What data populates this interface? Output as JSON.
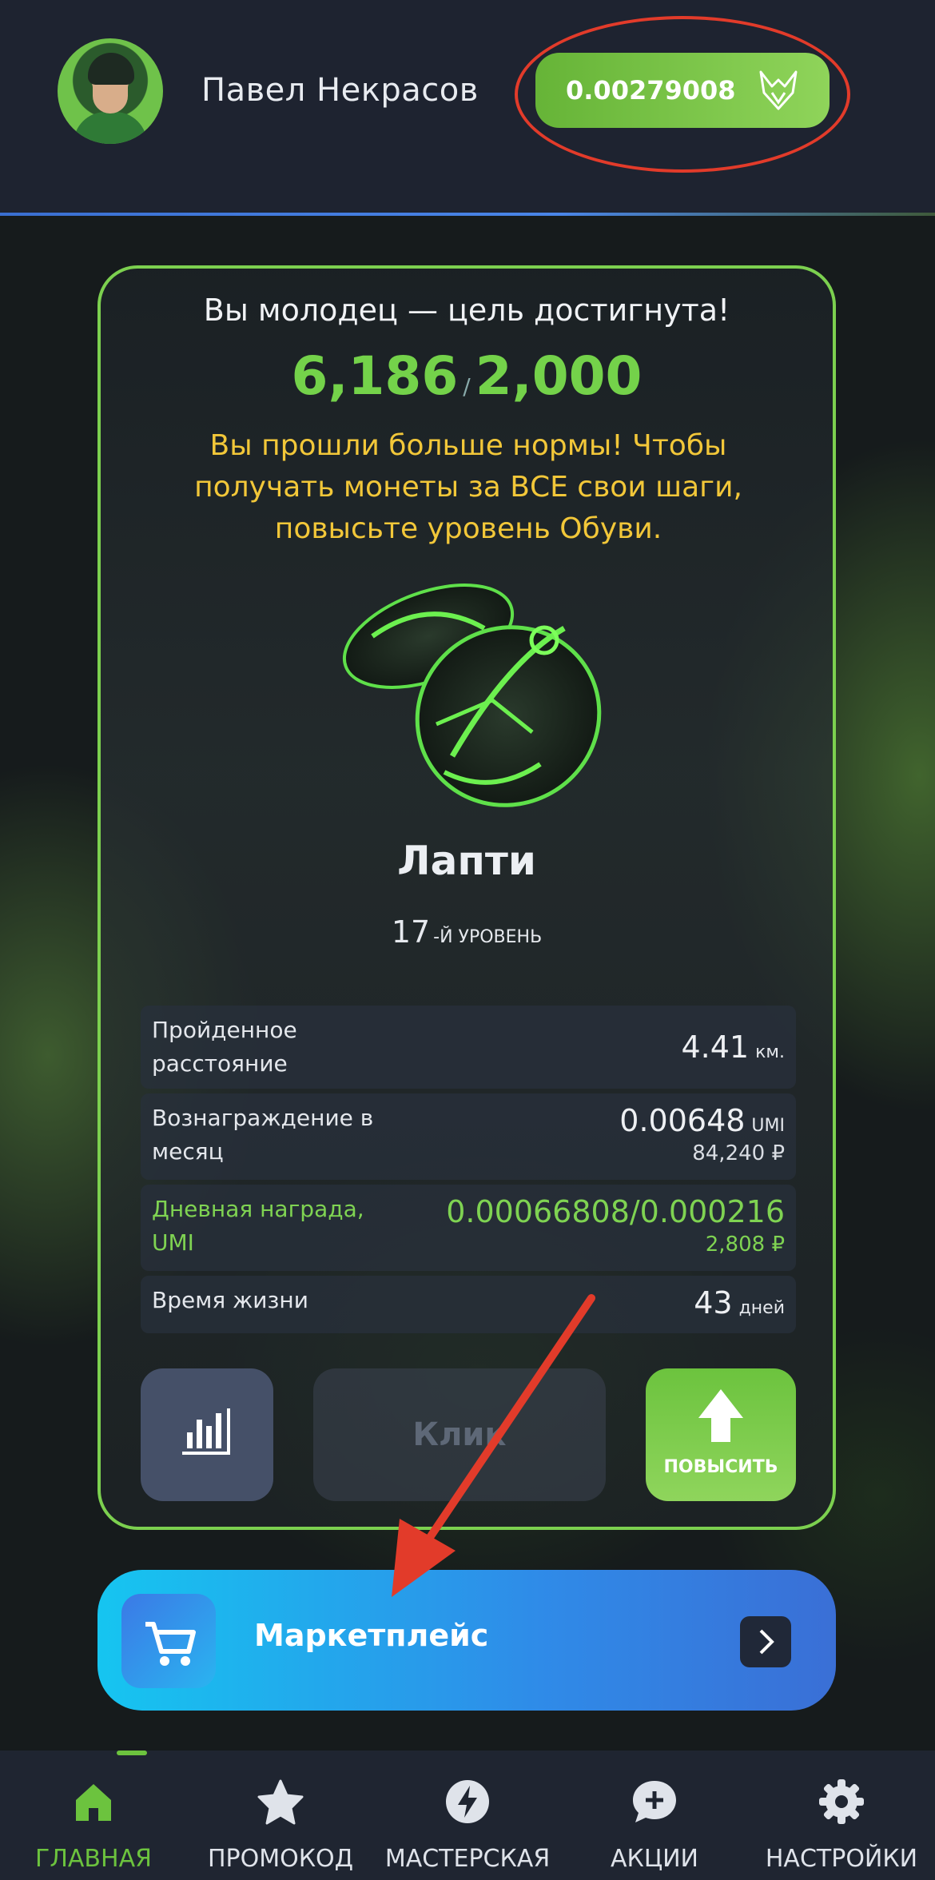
{
  "header": {
    "user_name": "Павел Некрасов",
    "balance": "0.00279008",
    "balance_icon": "fox-logo-icon"
  },
  "goal": {
    "title": "Вы молодец — цель достигнута!",
    "steps_done": "6,186",
    "steps_separator": "/",
    "steps_goal": "2,000",
    "warning": "Вы прошли больше нормы! Чтобы получать монеты за ВСЕ свои шаги, повысьте уровень Обуви."
  },
  "shoe": {
    "name": "Лапти",
    "level_number": "17",
    "level_text": "-Й УРОВЕНЬ"
  },
  "stats": [
    {
      "label": "Пройденное расстояние",
      "value": "4.41",
      "unit": "км.",
      "sub": ""
    },
    {
      "label": "Вознаграждение в месяц",
      "value": "0.00648",
      "unit": "UMI",
      "sub": "84,240 ₽"
    },
    {
      "label": "Дневная награда, UMI",
      "value": "0.00066808/0.000216",
      "unit": "",
      "sub": "2,808 ₽"
    },
    {
      "label": "Время жизни",
      "value": "43",
      "unit": "дней",
      "sub": ""
    }
  ],
  "actions": {
    "click_label": "Клик",
    "upgrade_label": "ПОВЫСИТЬ"
  },
  "market": {
    "label": "Маркетплейс"
  },
  "nav": [
    {
      "label": "ГЛАВНАЯ",
      "icon": "home-icon",
      "active": true
    },
    {
      "label": "ПРОМОКОД",
      "icon": "star-icon",
      "active": false
    },
    {
      "label": "МАСТЕРСКАЯ",
      "icon": "lightning-icon",
      "active": false
    },
    {
      "label": "АКЦИИ",
      "icon": "chat-plus-icon",
      "active": false
    },
    {
      "label": "НАСТРОЙКИ",
      "icon": "gear-icon",
      "active": false
    }
  ],
  "colors": {
    "accent_green": "#74d24a",
    "warning_yellow": "#f2c739",
    "annotation_red": "#e23b2a",
    "market_blue": "#16c5f0"
  }
}
